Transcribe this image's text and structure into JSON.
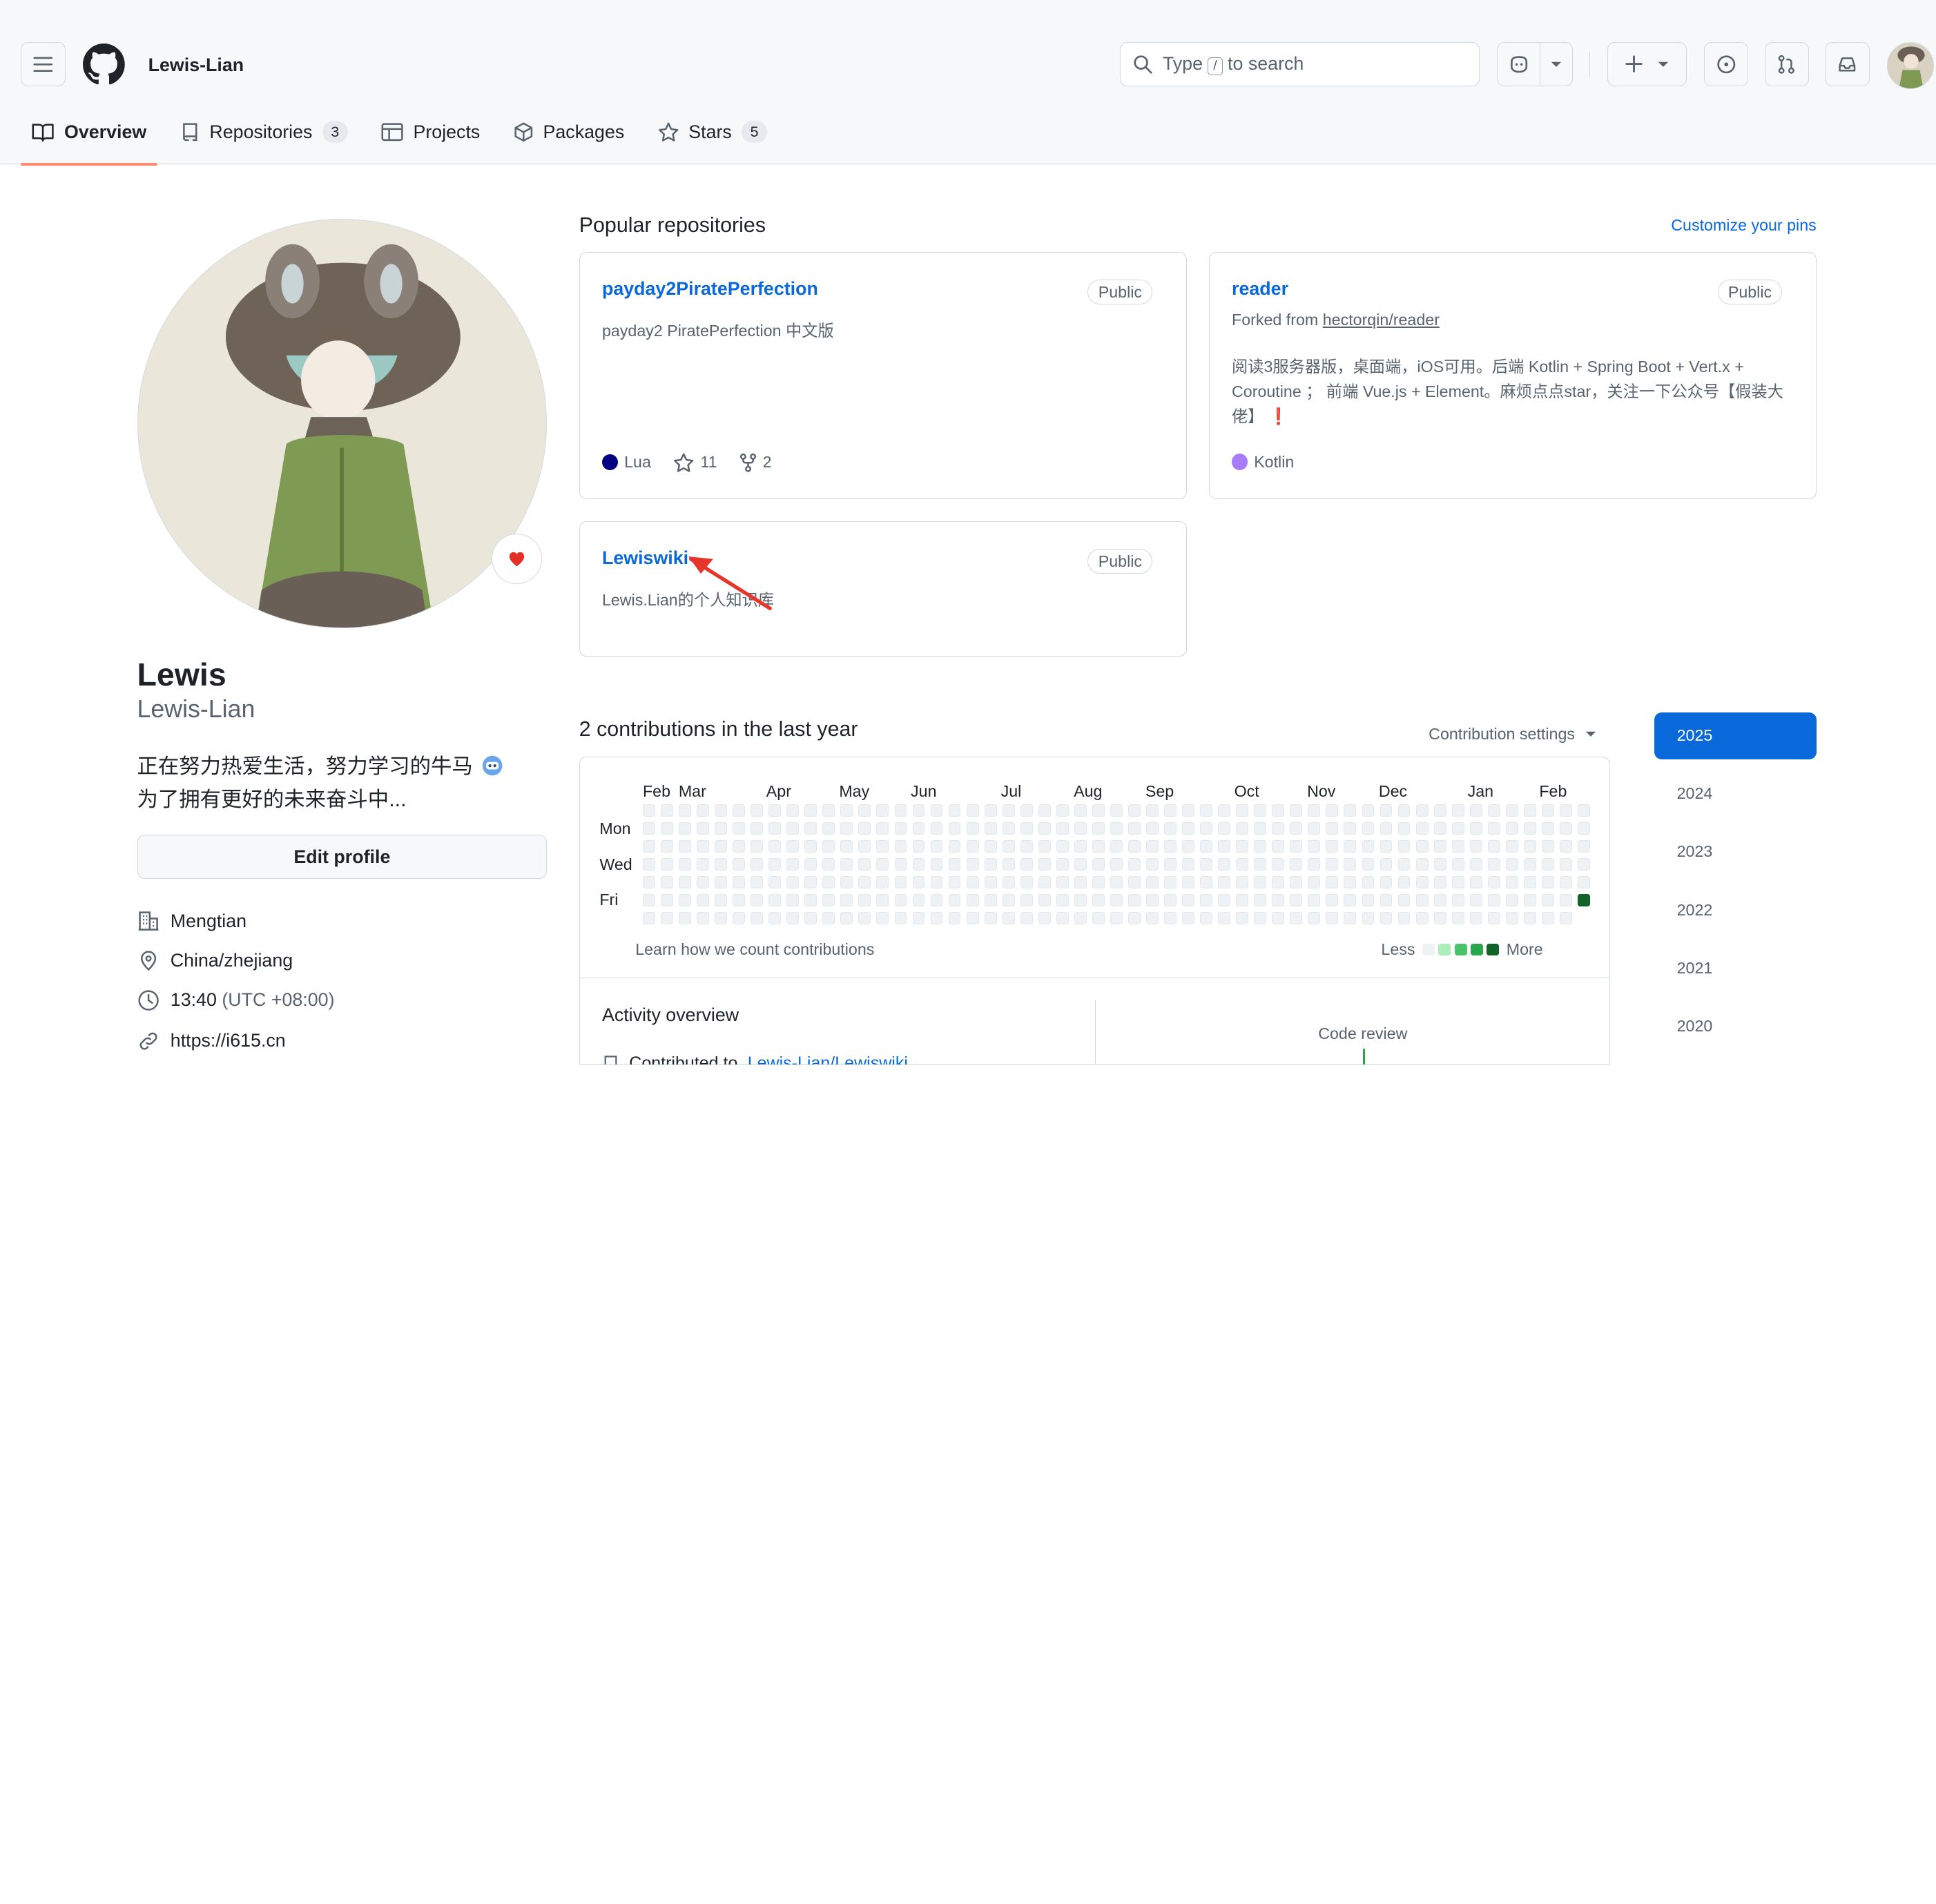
{
  "header": {
    "username": "Lewis-Lian",
    "search": {
      "prefix": "Type",
      "key": "/",
      "suffix": "to search"
    }
  },
  "tabs": [
    {
      "label": "Overview",
      "count": null
    },
    {
      "label": "Repositories",
      "count": "3"
    },
    {
      "label": "Projects",
      "count": null
    },
    {
      "label": "Packages",
      "count": null
    },
    {
      "label": "Stars",
      "count": "5"
    }
  ],
  "profile": {
    "name": "Lewis",
    "login": "Lewis-Lian",
    "bio_line1": "正在努力热爱生活，努力学习的牛马",
    "bio_line2": "为了拥有更好的未来奋斗中...",
    "edit_button": "Edit profile",
    "details": {
      "company": "Mengtian",
      "location": "China/zhejiang",
      "time": "13:40",
      "timezone": "(UTC +08:00)",
      "website": "https://i615.cn"
    }
  },
  "popular": {
    "title": "Popular repositories",
    "customize": "Customize your pins",
    "repos": [
      {
        "name": "payday2PiratePerfection",
        "visibility": "Public",
        "description": "payday2 PiratePerfection 中文版",
        "language": "Lua",
        "language_color": "#000080",
        "stars": "11",
        "forks": "2"
      },
      {
        "name": "reader",
        "visibility": "Public",
        "forked_prefix": "Forked from",
        "forked_from": "hectorqin/reader",
        "description": "阅读3服务器版，桌面端，iOS可用。后端 Kotlin + Spring Boot + Vert.x + Coroutine ； 前端 Vue.js + Element。麻烦点点star，关注一下公众号【假装大佬】 ❗",
        "language": "Kotlin",
        "language_color": "#A97BFF"
      },
      {
        "name": "Lewiswiki",
        "visibility": "Public",
        "description": "Lewis.Lian的个人知识库"
      }
    ]
  },
  "contributions": {
    "title": "2 contributions in the last year",
    "settings": "Contribution settings",
    "months": [
      "Feb",
      "Mar",
      "Apr",
      "May",
      "Jun",
      "Jul",
      "Aug",
      "Sep",
      "Oct",
      "Nov",
      "Dec",
      "Jan",
      "Feb"
    ],
    "days": [
      "Mon",
      "Wed",
      "Fri"
    ],
    "learn": "Learn how we count contributions",
    "less": "Less",
    "more": "More",
    "weeks": 53,
    "active_cells": [
      {
        "week": 52,
        "day": 5,
        "level": 4
      }
    ],
    "level_colors": [
      "#eff2f5",
      "#aceebb",
      "#4ac26b",
      "#2da44e",
      "#116329"
    ]
  },
  "years": [
    "2025",
    "2024",
    "2023",
    "2022",
    "2021",
    "2020"
  ],
  "activity": {
    "title": "Activity overview",
    "code_review": "Code review",
    "contributed_prefix": "Contributed to",
    "contributed_repo": "Lewis-Lian/Lewiswiki"
  }
}
